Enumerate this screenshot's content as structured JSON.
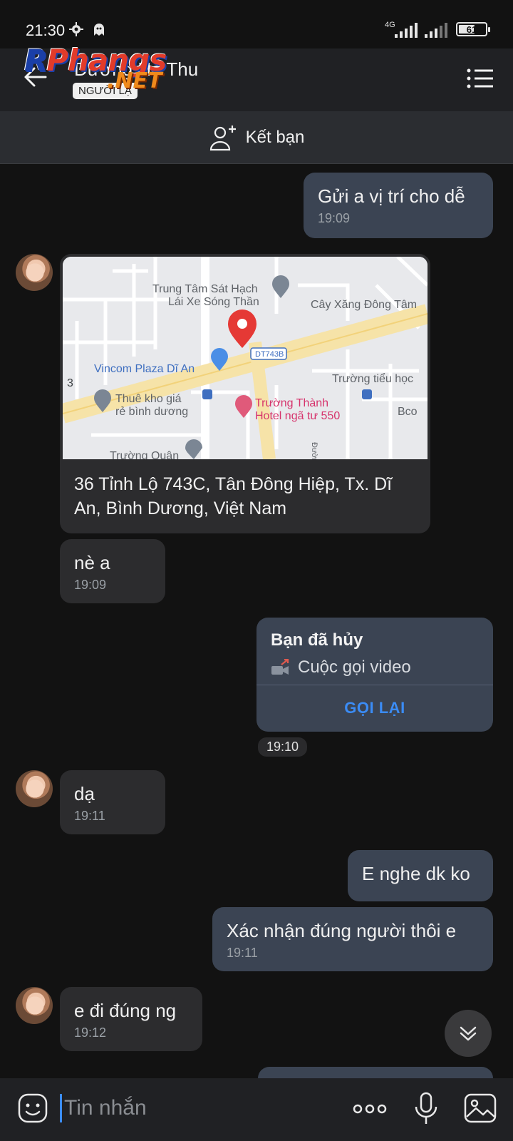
{
  "status_bar": {
    "time": "21:30",
    "network": "4G",
    "battery": "61",
    "battery_level": 0.61
  },
  "header": {
    "contact_name": "Dương Hà Thu",
    "contact_tag": "NGƯỜI LẠ",
    "watermark": "Phangs",
    "watermark_net": ".NET"
  },
  "add_friend": {
    "label": "Kết bạn"
  },
  "messages": {
    "m1": {
      "text": "Gửi a vị trí cho dễ",
      "time": "19:09"
    },
    "location": {
      "address": "36 Tỉnh Lộ 743C, Tân Đông Hiệp, Tx. Dĩ An, Bình Dương, Việt Nam",
      "map_labels": {
        "center": "Trung Tâm Sát Hạch",
        "center2": "Lái Xe Sóng Thần",
        "gas": "Cây Xăng Đông Tâm",
        "vincom": "Vincom Plaza Dĩ An",
        "road": "DT743B",
        "school": "Trường tiểu học",
        "warehouse1": "Thuê kho giá",
        "warehouse2": "rẻ bình dương",
        "hotel1": "Trường Thành",
        "hotel2": "Hotel ngã tư 550",
        "bottom": "Trường Quân",
        "bco": "Bco",
        "num": "3",
        "duong": "Đường"
      }
    },
    "m2": {
      "text": "nè a",
      "time": "19:09"
    },
    "call": {
      "title": "Bạn đã hủy",
      "subtitle": "Cuộc gọi video",
      "action": "GỌI LẠI",
      "time": "19:10"
    },
    "m3": {
      "text": "dạ",
      "time": "19:11"
    },
    "m4": {
      "text": "E nghe dk ko"
    },
    "m5": {
      "text": "Xác nhận đúng người thôi e",
      "time": "19:11"
    },
    "m6": {
      "text": "e đi đúng ng",
      "time": "19:12"
    }
  },
  "input": {
    "placeholder": "Tin nhắn"
  },
  "colors": {
    "accent": "#3b8cf5",
    "outgoing_bubble": "#3b4453",
    "incoming_bubble": "#2c2c2e",
    "map_pin": "#e53935"
  }
}
